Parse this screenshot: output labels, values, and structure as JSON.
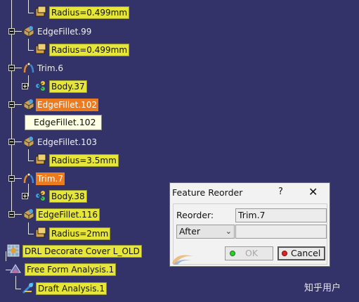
{
  "tree": {
    "items": [
      {
        "label": "Radius=0.499mm"
      },
      {
        "label": "EdgeFillet.99"
      },
      {
        "label": "Radius=0.499mm"
      },
      {
        "label": "Trim.6"
      },
      {
        "label": "Body.37"
      },
      {
        "label": "EdgeFillet.102"
      },
      {
        "label": "EdgeFillet.103"
      },
      {
        "label": "Radius=3.5mm"
      },
      {
        "label": "Trim.7"
      },
      {
        "label": "Body.38"
      },
      {
        "label": "EdgeFillet.116"
      },
      {
        "label": "Radius=2mm"
      },
      {
        "label": "DRL Decorate Cover L_OLD"
      },
      {
        "label": "Free Form Analysis.1"
      },
      {
        "label": "Draft Analysis.1"
      }
    ],
    "highlight_color": "#ee7a1e",
    "parameter_color": "#e6e63a"
  },
  "tooltip": {
    "text": "EdgeFillet.102"
  },
  "dialog": {
    "title": "Feature Reorder",
    "help": "?",
    "close": "✕",
    "reorder_label": "Reorder:",
    "reorder_value": "Trim.7",
    "position_option": "After",
    "ok_label": "OK",
    "cancel_label": "Cancel"
  },
  "watermark": "知乎用户"
}
